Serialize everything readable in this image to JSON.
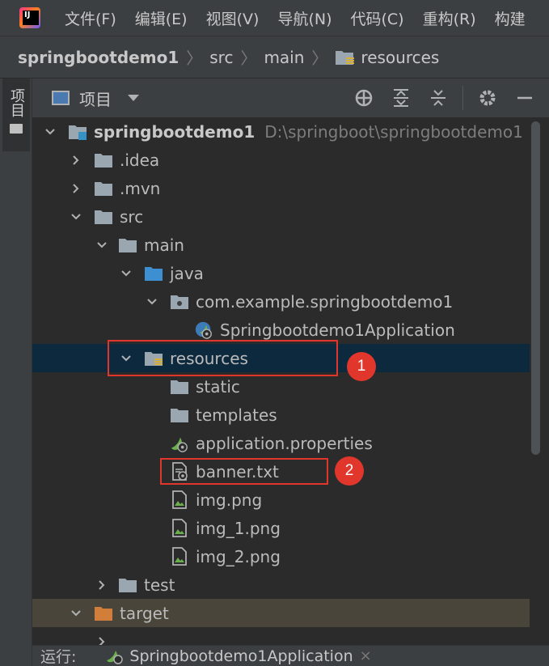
{
  "menu": {
    "items": [
      "文件(F)",
      "编辑(E)",
      "视图(V)",
      "导航(N)",
      "代码(C)",
      "重构(R)",
      "构建"
    ]
  },
  "breadcrumb": {
    "items": [
      "springbootdemo1",
      "src",
      "main",
      "resources"
    ]
  },
  "side_tab": {
    "label": "项目"
  },
  "panel": {
    "title": "项目"
  },
  "tree": {
    "root_label": "springbootdemo1",
    "root_path": "D:\\springboot\\springbootdemo1",
    "idea": ".idea",
    "mvn": ".mvn",
    "src": "src",
    "main": "main",
    "java": "java",
    "package": "com.example.springbootdemo1",
    "app_class": "Springbootdemo1Application",
    "resources": "resources",
    "static": "static",
    "templates": "templates",
    "app_properties": "application.properties",
    "banner": "banner.txt",
    "img": "img.png",
    "img1": "img_1.png",
    "img2": "img_2.png",
    "test": "test",
    "target": "target"
  },
  "annotations": {
    "badge1": "1",
    "badge2": "2"
  },
  "run_bar": {
    "label": "运行:",
    "tab": "Springbootdemo1Application",
    "close": "×"
  },
  "colors": {
    "selection": "#0d293e",
    "annotation": "#e0362c",
    "target_bg": "#49453a",
    "folder": "#9aa7b0"
  }
}
